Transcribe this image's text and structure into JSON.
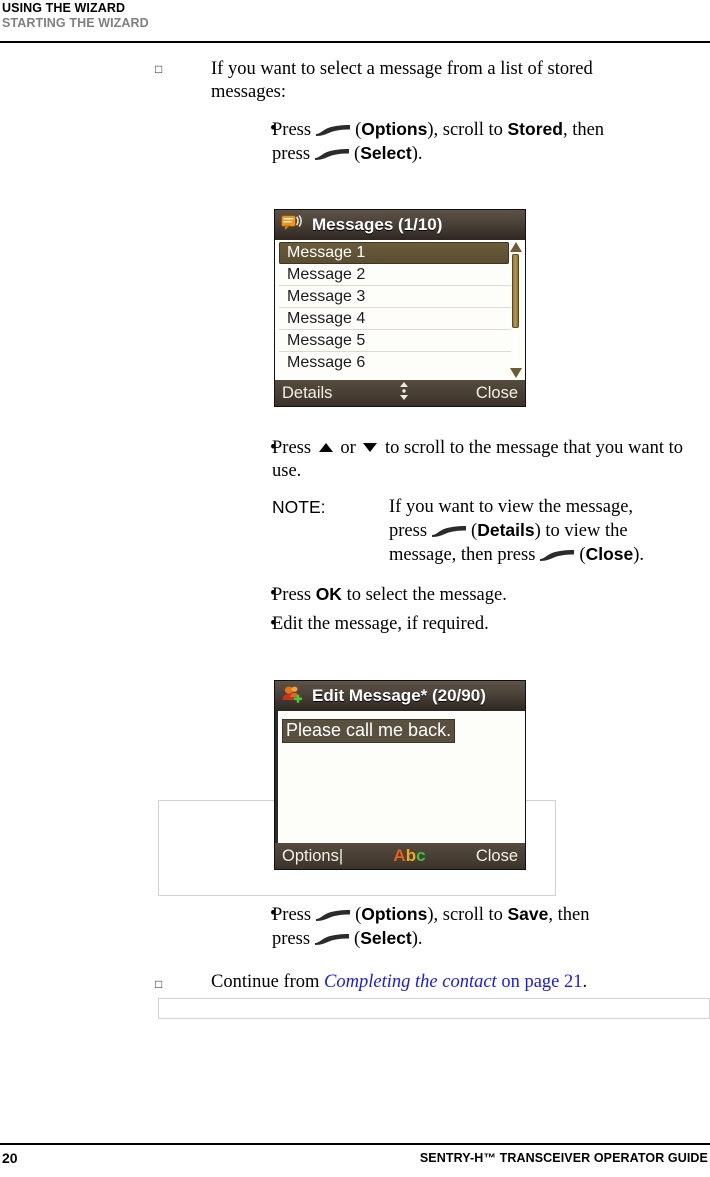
{
  "running_head": {
    "line1": "USING THE WIZARD",
    "line2": "STARTING THE WIZARD"
  },
  "content": {
    "step1_intro": "If you want to select a message from a list of stored messages:",
    "bullet1": {
      "press_word": "Press",
      "softkey_label_1": "Options",
      "mid_text": "), scroll to",
      "target_1": "Stored",
      "then_word": ", then",
      "press_word_2": "press",
      "softkey_label_2": "Select",
      "tail": ")."
    },
    "bullet2": {
      "text_before": "Press",
      "or_word": "or",
      "text_after": "to scroll to the message that you want to use."
    },
    "note": {
      "label": "NOTE:",
      "line1": "If you want to view the message,",
      "line2_a": "press",
      "line2_key": "Details",
      "line2_b": ") to view the",
      "line3_a": "message, then press",
      "line3_key": "Close",
      "line3_b": ")."
    },
    "bullet3": {
      "text_a": "Press",
      "key": "OK",
      "text_b": "to select the message."
    },
    "bullet4": "Edit the message, if required.",
    "bullet5": {
      "press_word": "Press",
      "softkey_label_1": "Options",
      "mid_text": "), scroll to",
      "target_1": "Save",
      "then_word": ", then",
      "press_word_2": "press",
      "softkey_label_2": "Select",
      "tail": ")."
    },
    "step2": {
      "text_a": "Continue from",
      "link_italic": "Completing the contact",
      "link_plain": " on page 21",
      "text_b": "."
    }
  },
  "screen_messages": {
    "icon": "message-bubble-icon",
    "title": "Messages (1/10)",
    "items": [
      {
        "label": "Message 1",
        "selected": true
      },
      {
        "label": "Message 2",
        "selected": false
      },
      {
        "label": "Message 3",
        "selected": false
      },
      {
        "label": "Message 4",
        "selected": false
      },
      {
        "label": "Message 5",
        "selected": false
      },
      {
        "label": "Message 6",
        "selected": false
      }
    ],
    "softkey_left": "Details",
    "softkey_mid": "scroll-updown-icon",
    "softkey_right": "Close"
  },
  "screen_edit": {
    "icon": "add-contact-icon",
    "title": "Edit Message* (20/90)",
    "body_text": "Please call me back.",
    "softkey_left": "Options",
    "softkey_caret": "|",
    "softkey_mid_a": "A",
    "softkey_mid_b": "b",
    "softkey_mid_c": "c",
    "softkey_right": "Close"
  },
  "footer": {
    "page_number": "20",
    "guide_title": "SENTRY-H™ TRANSCEIVER OPERATOR GUIDE"
  },
  "colors": {
    "link": "#1a1ae0",
    "header_grey": "#808080",
    "screen_titlebar": "#4a4138",
    "screen_selection": "#5a4d30",
    "scrollbar_gold": "#b99d52"
  }
}
